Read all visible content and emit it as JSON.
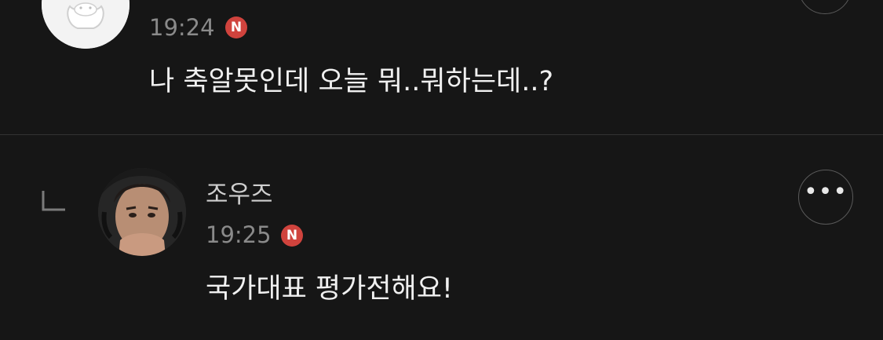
{
  "comments": [
    {
      "author": "",
      "time": "19:24",
      "badge": "N",
      "text": "나 축알못인데 오늘 뭐..뭐하는데..?",
      "avatar_icon": "cartoon-character-icon",
      "more_icon": "more-options-icon"
    },
    {
      "author": "조우즈",
      "time": "19:25",
      "badge": "N",
      "text": "국가대표 평가전해요!",
      "avatar_icon": "profile-photo",
      "more_icon": "more-options-icon",
      "more_glyph": "•••",
      "reply_marker_icon": "reply-arrow-icon"
    }
  ],
  "colors": {
    "background": "#161616",
    "badge": "#d0433d",
    "divider": "#333333",
    "time": "#8a8a8a",
    "text": "#f0f0f0"
  }
}
